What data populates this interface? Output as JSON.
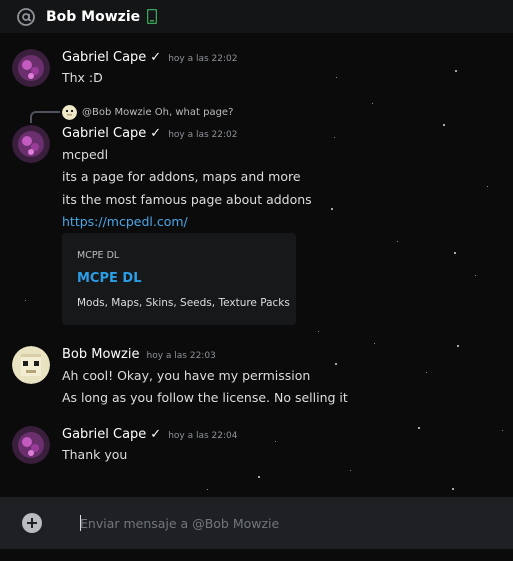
{
  "header": {
    "title": "Bob Mowzie",
    "at_icon": "at-sign-icon",
    "status_icon": "mobile-online-icon",
    "status_color": "#3ba55c"
  },
  "messages": [
    {
      "author": "Gabriel Cape",
      "verified": "✓",
      "timestamp": "hoy a las 22:02",
      "lines": [
        "Thx :D"
      ]
    },
    {
      "reply": {
        "text": "@Bob Mowzie Oh, what page?"
      },
      "author": "Gabriel Cape",
      "verified": "✓",
      "timestamp": "hoy a las 22:02",
      "lines": [
        "mcpedl",
        "its a page for addons, maps and more",
        "its the most famous page about addons"
      ],
      "link": "https://mcpedl.com/",
      "embed": {
        "provider": "MCPE DL",
        "title": "MCPE DL",
        "description": "Mods, Maps, Skins, Seeds, Texture Packs"
      }
    },
    {
      "author": "Bob Mowzie",
      "timestamp": "hoy a las 22:03",
      "lines": [
        "Ah cool! Okay, you have my permission",
        "As long as you follow the license. No selling it"
      ]
    },
    {
      "author": "Gabriel Cape",
      "verified": "✓",
      "timestamp": "hoy a las 22:04",
      "lines": [
        "Thank you"
      ]
    }
  ],
  "composer": {
    "placeholder": "Enviar mensaje a @Bob Mowzie",
    "add_icon": "plus-circle-icon"
  },
  "colors": {
    "background": "#0b0b0c",
    "link": "#4aa6e6",
    "embed_title": "#2a9fe8"
  }
}
